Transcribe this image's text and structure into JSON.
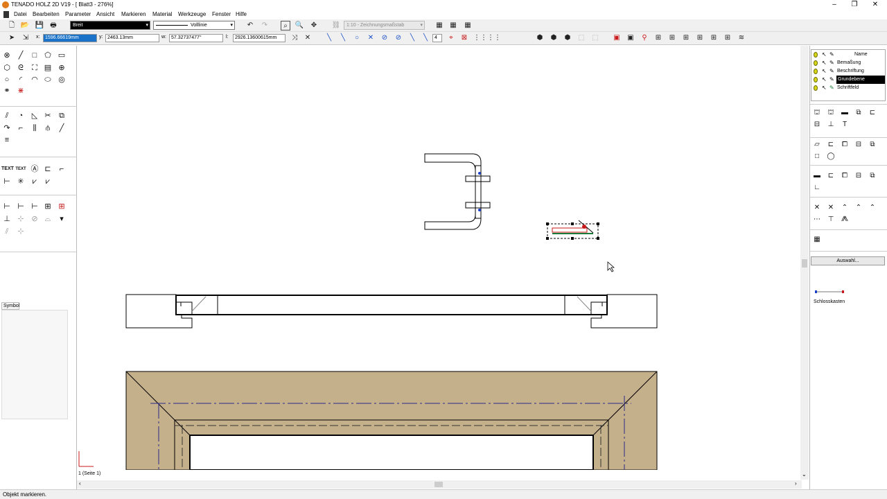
{
  "window": {
    "title": "TENADO HOLZ 2D V19 - [ Blatt3 - 276%]",
    "minimize": "–",
    "restore": "❐",
    "close": "✕"
  },
  "menu": [
    "Datei",
    "Bearbeiten",
    "Parameter",
    "Ansicht",
    "Markieren",
    "Material",
    "Werkzeuge",
    "Fenster",
    "Hilfe"
  ],
  "toolbar1": {
    "pen_combo": "Breit",
    "line_combo": "Volllinie",
    "scale_combo": "1:10 - Zeichnungsmaßstab"
  },
  "toolbar2": {
    "x_label": "x:",
    "x_value": "1596.66619mm",
    "y_label": "y:",
    "y_value": "2463.13mm",
    "w_label": "w:",
    "w_value": "57.32737477°",
    "l_label": "l:",
    "l_value": "2926.13600615mm",
    "step_value": "4"
  },
  "left_panel": {
    "symbol_tab": "Symbol"
  },
  "right_panel": {
    "layers_header": "Name",
    "layers": [
      "Bemaßung",
      "Beschriftung",
      "Grundebene",
      "Schriftfeld"
    ],
    "active_layer": "Grundebene",
    "auswahl_button": "Auswahl...",
    "symbol_item": "Schlosskasten"
  },
  "canvas": {
    "page_tab": "1 (Seite 1)"
  },
  "status": {
    "text": "Objekt markieren."
  },
  "colors": {
    "wood": "#c4b08a",
    "highlight": "#000000",
    "accent": "#1a73c8"
  }
}
